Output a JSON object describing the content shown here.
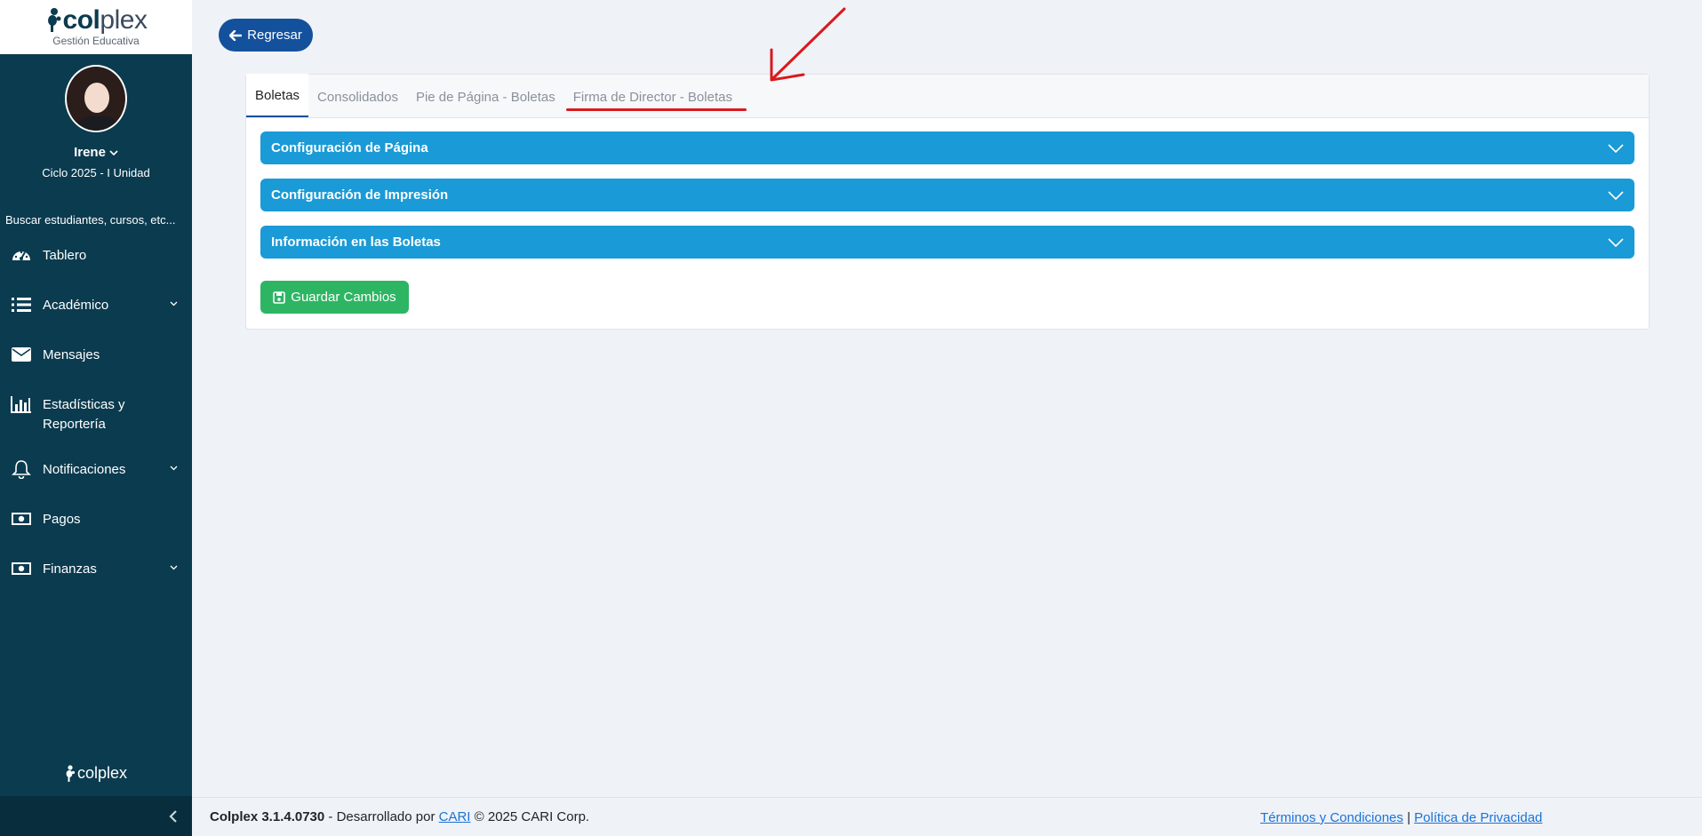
{
  "sidebar": {
    "logo_main": "col",
    "logo_accent": "plex",
    "logo_subtitle": "Gestión Educativa",
    "user_name": "Irene",
    "cycle": "Ciclo 2025 - I Unidad",
    "search_placeholder": "Buscar estudiantes, cursos, etc...",
    "items": [
      {
        "label": "Tablero",
        "icon": "dashboard-icon"
      },
      {
        "label": "Académico",
        "icon": "list-icon",
        "has_children": true
      },
      {
        "label": "Mensajes",
        "icon": "envelope-icon"
      },
      {
        "label": "Estadísticas y Reportería",
        "icon": "bar-chart-icon"
      },
      {
        "label": "Notificaciones",
        "icon": "bell-icon",
        "has_children": true
      },
      {
        "label": "Pagos",
        "icon": "money-icon"
      },
      {
        "label": "Finanzas",
        "icon": "money-icon",
        "has_children": true
      }
    ],
    "footer_logo": "colplex"
  },
  "header": {
    "back_label": "Regresar"
  },
  "tabs": [
    {
      "label": "Boletas",
      "active": true
    },
    {
      "label": "Consolidados",
      "active": false
    },
    {
      "label": "Pie de Página - Boletas",
      "active": false
    },
    {
      "label": "Firma de Director - Boletas",
      "active": false
    }
  ],
  "accordion": [
    {
      "label": "Configuración de Página"
    },
    {
      "label": "Configuración de Impresión"
    },
    {
      "label": "Información en las Boletas"
    }
  ],
  "save_label": "Guardar Cambios",
  "footer": {
    "version": "Colplex 3.1.4.0730",
    "developed_by": " - Desarrollado por ",
    "cari_link": "CARI",
    "copyright": " © 2025 CARI Corp.",
    "terms": "Términos y Condiciones",
    "separator": " | ",
    "privacy": "Política de Privacidad"
  },
  "colors": {
    "sidebar_bg": "#0b3b4f",
    "accent_blue": "#1a9ad6",
    "back_button": "#14519c",
    "save_green": "#2eb564",
    "annotation_red": "#d9191c"
  }
}
